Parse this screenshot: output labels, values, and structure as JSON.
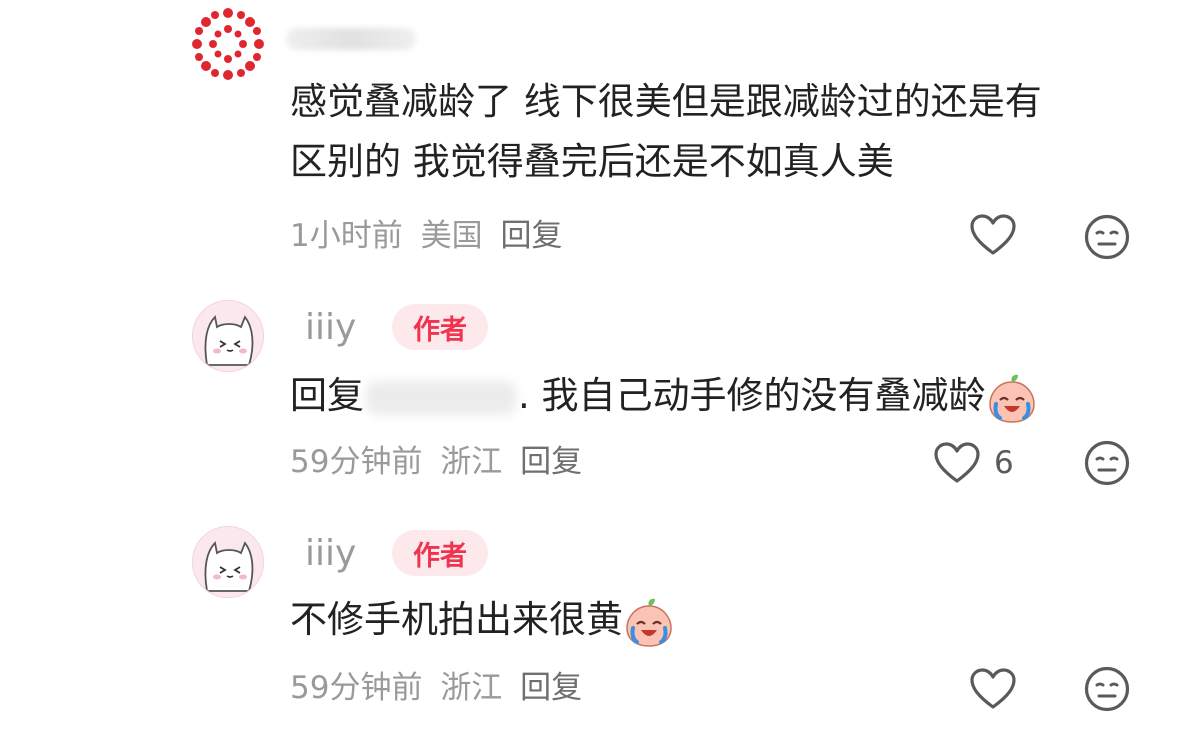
{
  "comments": [
    {
      "username": "",
      "text_line1": "感觉叠减龄了 线下很美但是跟减龄过的还是有",
      "text_line2": "区别的 我觉得叠完后还是不如真人美",
      "time": "1小时前",
      "location": "美国",
      "reply": "回复",
      "likes": ""
    },
    {
      "username": "iiiy",
      "badge": "作者",
      "reply_prefix": "回复",
      "text": "我自己动手修的没有叠减龄",
      "time": "59分钟前",
      "location": "浙江",
      "reply": "回复",
      "likes": "6"
    },
    {
      "username": "iiiy",
      "badge": "作者",
      "text": "不修手机拍出来很黄",
      "time": "59分钟前",
      "location": "浙江",
      "reply": "回复",
      "likes": ""
    }
  ],
  "icons": {
    "like": "heart-outline-icon",
    "dislike": "meh-face-icon",
    "emoji": "crying-peach-emoji"
  },
  "colors": {
    "badge_text": "#f0344f",
    "badge_bg": "#fde9ec",
    "meta": "#9a9a9a"
  }
}
